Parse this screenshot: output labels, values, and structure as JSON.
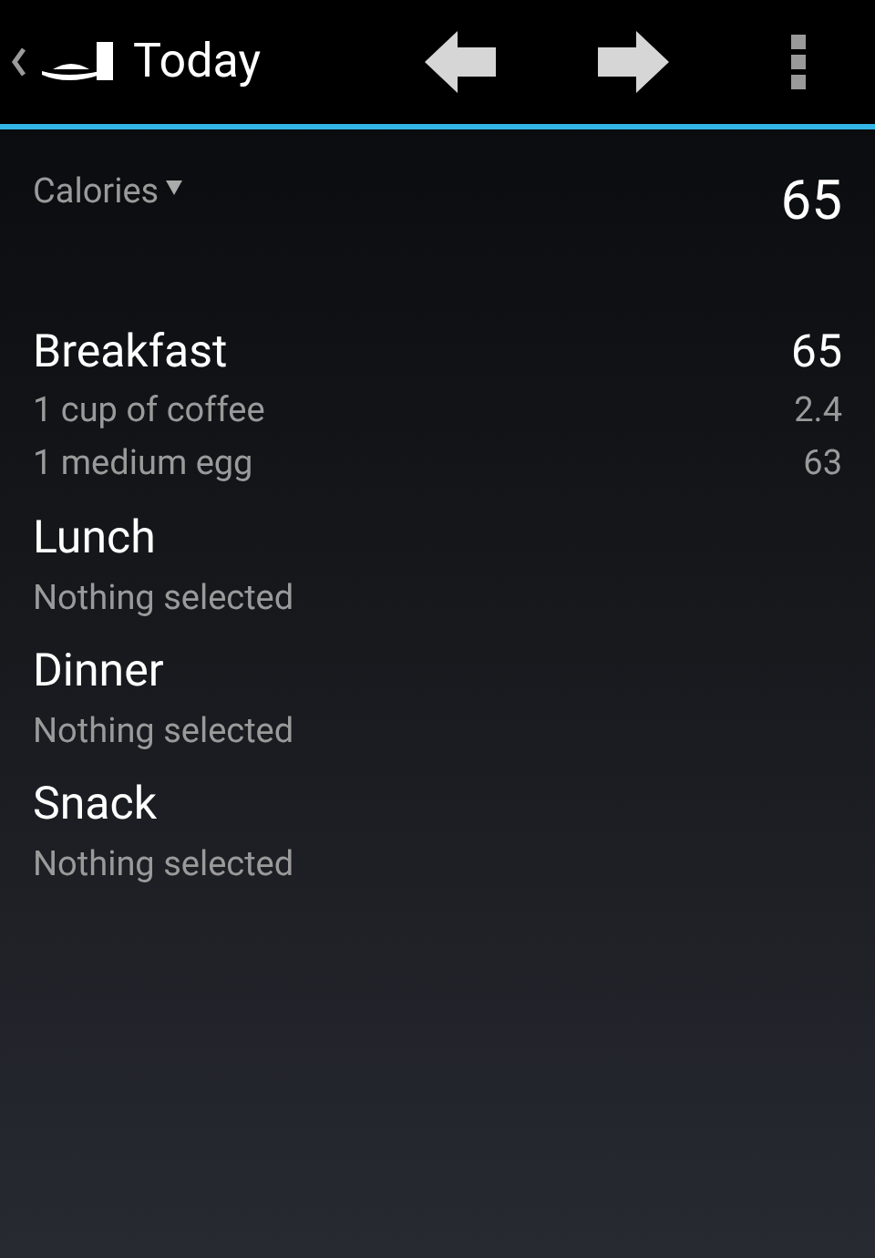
{
  "action_bar": {
    "title": "Today"
  },
  "summary": {
    "label": "Calories",
    "value": "65"
  },
  "meals": [
    {
      "name": "Breakfast",
      "total": "65",
      "items": [
        {
          "name": "1 cup of coffee",
          "value": "2.4"
        },
        {
          "name": "1 medium egg",
          "value": "63"
        }
      ]
    },
    {
      "name": "Lunch",
      "note": "Nothing selected"
    },
    {
      "name": "Dinner",
      "note": "Nothing selected"
    },
    {
      "name": "Snack",
      "note": "Nothing selected"
    }
  ]
}
